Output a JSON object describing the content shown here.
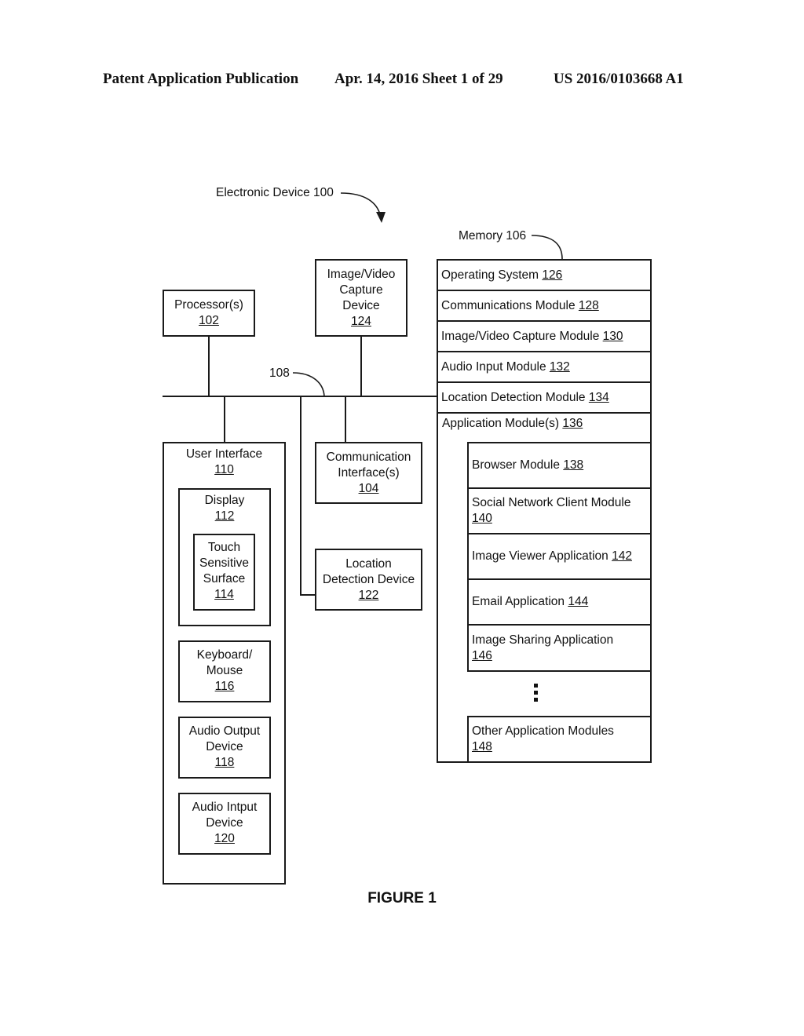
{
  "header": {
    "left": "Patent Application Publication",
    "middle": "Apr. 14, 2016  Sheet 1 of 29",
    "right": "US 2016/0103668 A1"
  },
  "device_label": "Electronic Device 100",
  "bus_label": "108",
  "memory_label": "Memory 106",
  "processor": {
    "name": "Processor(s)",
    "ref": "102"
  },
  "capture_device": {
    "lines": [
      "Image/Video",
      "Capture",
      "Device"
    ],
    "ref": "124"
  },
  "comm_interface": {
    "lines": [
      "Communication",
      "Interface(s)"
    ],
    "ref": "104"
  },
  "location_device": {
    "lines": [
      "Location",
      "Detection Device"
    ],
    "ref": "122"
  },
  "user_interface": {
    "name": "User Interface",
    "ref": "110",
    "display": {
      "name": "Display",
      "ref": "112"
    },
    "touch": {
      "lines": [
        "Touch",
        "Sensitive",
        "Surface"
      ],
      "ref": "114"
    },
    "keyboard": {
      "lines": [
        "Keyboard/",
        "Mouse"
      ],
      "ref": "116"
    },
    "audio_out": {
      "lines": [
        "Audio Output",
        "Device"
      ],
      "ref": "118"
    },
    "audio_in": {
      "lines": [
        "Audio Intput",
        "Device"
      ],
      "ref": "120"
    }
  },
  "memory_rows": [
    {
      "name": "Operating System",
      "ref": "126"
    },
    {
      "name": "Communications Module",
      "ref": "128"
    },
    {
      "name": "Image/Video Capture Module",
      "ref": "130"
    },
    {
      "name": "Audio Input Module",
      "ref": "132"
    },
    {
      "name": "Location Detection Module",
      "ref": "134"
    },
    {
      "name": "Application Module(s)",
      "ref": "136"
    }
  ],
  "app_modules": [
    {
      "name": "Browser Module",
      "ref": "138"
    },
    {
      "name": "Social Network Client Module",
      "ref": "140"
    },
    {
      "name": "Image Viewer Application",
      "ref": "142"
    },
    {
      "name": "Email Application",
      "ref": "144"
    },
    {
      "name": "Image Sharing Application",
      "ref": "146"
    }
  ],
  "other_modules": {
    "name": "Other Application Modules",
    "ref": "148"
  },
  "figure_caption": "FIGURE 1"
}
